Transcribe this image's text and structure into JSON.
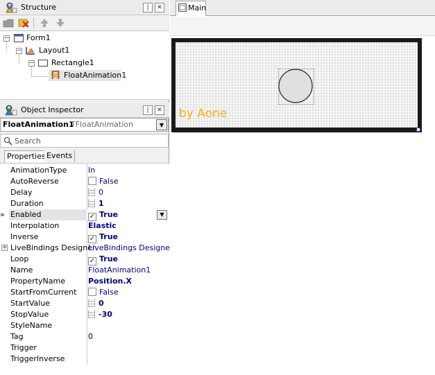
{
  "structure_panel": {
    "title": "Structure",
    "pin_glyph": "❘",
    "close_glyph": "✕",
    "tree": [
      {
        "label": "Form1",
        "icon": "form-icon",
        "expanded": true
      },
      {
        "label": "Layout1",
        "icon": "layout-icon",
        "expanded": true
      },
      {
        "label": "Rectangle1",
        "icon": "rectangle-icon",
        "expanded": true
      },
      {
        "label": "FloatAnimation1",
        "icon": "float-animation-icon",
        "selected": true
      }
    ]
  },
  "inspector": {
    "title": "Object Inspector",
    "selected_component": "FloatAnimation1",
    "selected_type": "TFloatAnimation",
    "search_placeholder": "Search",
    "tabs": [
      "Properties",
      "Events"
    ],
    "properties": [
      {
        "name": "AnimationType",
        "value": "In",
        "kind": "text"
      },
      {
        "name": "AutoReverse",
        "value": "False",
        "kind": "check",
        "checked": false
      },
      {
        "name": "Delay",
        "value": "0",
        "kind": "number"
      },
      {
        "name": "Duration",
        "value": "1",
        "kind": "number",
        "bold": true
      },
      {
        "name": "Enabled",
        "value": "True",
        "kind": "check",
        "checked": true,
        "bold": true,
        "active": true
      },
      {
        "name": "Interpolation",
        "value": "Elastic",
        "kind": "text",
        "bold": true
      },
      {
        "name": "Inverse",
        "value": "True",
        "kind": "check",
        "checked": true,
        "bold": true
      },
      {
        "name": "LiveBindings Designer",
        "value": "LiveBindings Designer",
        "kind": "text",
        "expandable": true
      },
      {
        "name": "Loop",
        "value": "True",
        "kind": "check",
        "checked": true,
        "bold": true
      },
      {
        "name": "Name",
        "value": "FloatAnimation1",
        "kind": "text"
      },
      {
        "name": "PropertyName",
        "value": "Position.X",
        "kind": "text",
        "bold": true
      },
      {
        "name": "StartFromCurrent",
        "value": "False",
        "kind": "check",
        "checked": false
      },
      {
        "name": "StartValue",
        "value": "0",
        "kind": "number",
        "bold": true
      },
      {
        "name": "StopValue",
        "value": "-30",
        "kind": "number",
        "bold": true
      },
      {
        "name": "StyleName",
        "value": "",
        "kind": "text"
      },
      {
        "name": "Tag",
        "value": "0",
        "kind": "plain"
      },
      {
        "name": "Trigger",
        "value": "",
        "kind": "text"
      },
      {
        "name": "TriggerInverse",
        "value": "",
        "kind": "text"
      }
    ]
  },
  "designer": {
    "tab_label": "Main",
    "watermark": "by Aone"
  },
  "colors": {
    "watermark": "#f3b21c",
    "value_blue": "#000080",
    "selection": "#e4e4e4"
  }
}
